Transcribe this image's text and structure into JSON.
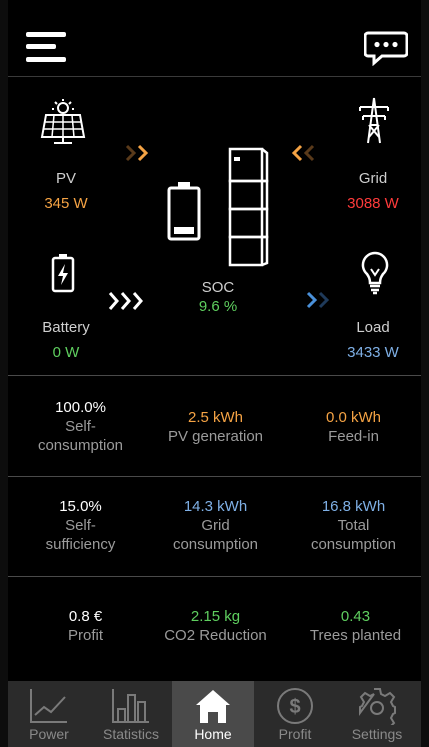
{
  "flow": {
    "pv": {
      "label": "PV",
      "value": "345 W"
    },
    "grid": {
      "label": "Grid",
      "value": "3088 W"
    },
    "battery": {
      "label": "Battery",
      "value": "0 W"
    },
    "load": {
      "label": "Load",
      "value": "3433 W"
    },
    "soc": {
      "label": "SOC",
      "value": "9.6 %"
    }
  },
  "stats": [
    [
      {
        "value": "100.0%",
        "label": "Self-\nconsumption",
        "color": "#ffffff"
      },
      {
        "value": "2.5 kWh",
        "label": "PV generation",
        "color": "#f5a344"
      },
      {
        "value": "0.0 kWh",
        "label": "Feed-in",
        "color": "#f5a344"
      }
    ],
    [
      {
        "value": "15.0%",
        "label": "Self-\nsufficiency",
        "color": "#ffffff"
      },
      {
        "value": "14.3 kWh",
        "label": "Grid\nconsumption",
        "color": "#7fb0e6"
      },
      {
        "value": "16.8 kWh",
        "label": "Total\nconsumption",
        "color": "#7fb0e6"
      }
    ],
    [
      {
        "value": "0.8 €",
        "label": "Profit",
        "color": "#ffffff"
      },
      {
        "value": "2.15 kg",
        "label": "CO2 Reduction",
        "color": "#5fcf5f"
      },
      {
        "value": "0.43",
        "label": "Trees planted",
        "color": "#5fcf5f"
      }
    ]
  ],
  "tabs": [
    {
      "label": "Power",
      "icon": "line-chart-icon"
    },
    {
      "label": "Statistics",
      "icon": "bar-chart-icon"
    },
    {
      "label": "Home",
      "icon": "home-icon"
    },
    {
      "label": "Profit",
      "icon": "dollar-icon"
    },
    {
      "label": "Settings",
      "icon": "gear-icon"
    }
  ],
  "active_tab": "Home",
  "colors": {
    "pv": "#f5a344",
    "grid": "#ff3b3b",
    "battery": "#5fcf5f",
    "load": "#7fb0e6",
    "soc": "#5fcf5f"
  }
}
